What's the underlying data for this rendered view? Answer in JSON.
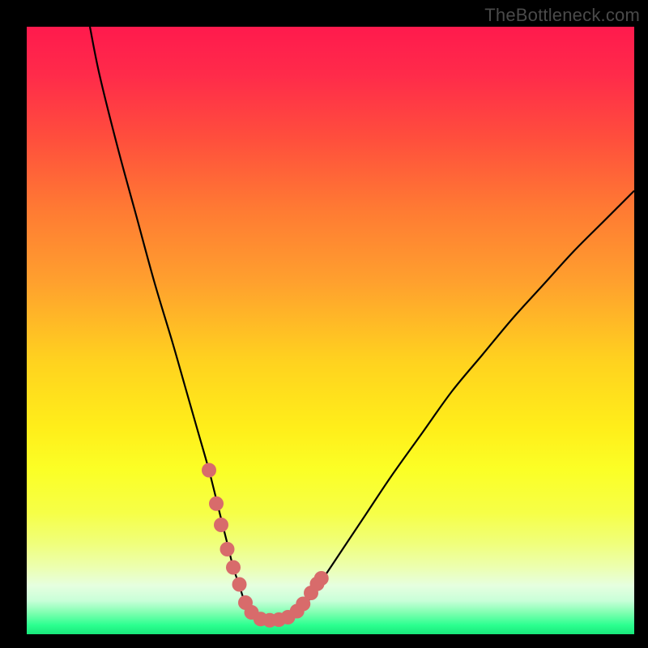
{
  "watermark": "TheBottleneck.com",
  "chart_data": {
    "type": "line",
    "title": "",
    "xlabel": "",
    "ylabel": "",
    "xlim": [
      0,
      100
    ],
    "ylim": [
      0,
      100
    ],
    "series": [
      {
        "name": "curve",
        "color": "#000000",
        "x": [
          10.4,
          12,
          15,
          18,
          21,
          24,
          26,
          28,
          30,
          31.5,
          33,
          34,
          35,
          36,
          37,
          38,
          40,
          42,
          44,
          46,
          48,
          52,
          56,
          60,
          65,
          70,
          75,
          80,
          85,
          90,
          95,
          100
        ],
        "y": [
          100,
          92,
          80,
          69,
          58,
          48,
          41,
          34,
          27,
          21,
          15,
          11,
          8,
          5,
          3.5,
          2.5,
          2.3,
          2.4,
          3,
          5,
          8,
          14,
          20,
          26,
          33,
          40,
          46,
          52,
          57.5,
          63,
          68,
          73
        ]
      }
    ],
    "highlight_points": {
      "color": "#d86b6b",
      "points": [
        {
          "x": 30.0,
          "y": 27
        },
        {
          "x": 31.2,
          "y": 21.5
        },
        {
          "x": 32.0,
          "y": 18
        },
        {
          "x": 33.0,
          "y": 14
        },
        {
          "x": 34.0,
          "y": 11
        },
        {
          "x": 35.0,
          "y": 8.2
        },
        {
          "x": 36.0,
          "y": 5.2
        },
        {
          "x": 37.0,
          "y": 3.6
        },
        {
          "x": 38.5,
          "y": 2.5
        },
        {
          "x": 40.0,
          "y": 2.3
        },
        {
          "x": 41.5,
          "y": 2.4
        },
        {
          "x": 43.0,
          "y": 2.8
        },
        {
          "x": 44.5,
          "y": 3.8
        },
        {
          "x": 45.5,
          "y": 5.0
        },
        {
          "x": 46.8,
          "y": 6.8
        },
        {
          "x": 47.8,
          "y": 8.3
        },
        {
          "x": 48.5,
          "y": 9.2
        }
      ]
    },
    "gradient_stops": [
      {
        "offset": 0.0,
        "color": "#ff1a4d"
      },
      {
        "offset": 0.08,
        "color": "#ff2b4a"
      },
      {
        "offset": 0.18,
        "color": "#ff4d3d"
      },
      {
        "offset": 0.3,
        "color": "#ff7a33"
      },
      {
        "offset": 0.42,
        "color": "#ffa02e"
      },
      {
        "offset": 0.55,
        "color": "#ffd21f"
      },
      {
        "offset": 0.66,
        "color": "#ffee1a"
      },
      {
        "offset": 0.73,
        "color": "#fbff26"
      },
      {
        "offset": 0.8,
        "color": "#f6ff47"
      },
      {
        "offset": 0.85,
        "color": "#f0ff7a"
      },
      {
        "offset": 0.89,
        "color": "#ecffb0"
      },
      {
        "offset": 0.92,
        "color": "#e6ffe0"
      },
      {
        "offset": 0.945,
        "color": "#c8ffd8"
      },
      {
        "offset": 0.965,
        "color": "#7effb0"
      },
      {
        "offset": 0.985,
        "color": "#2cff90"
      },
      {
        "offset": 1.0,
        "color": "#18e87a"
      }
    ]
  }
}
